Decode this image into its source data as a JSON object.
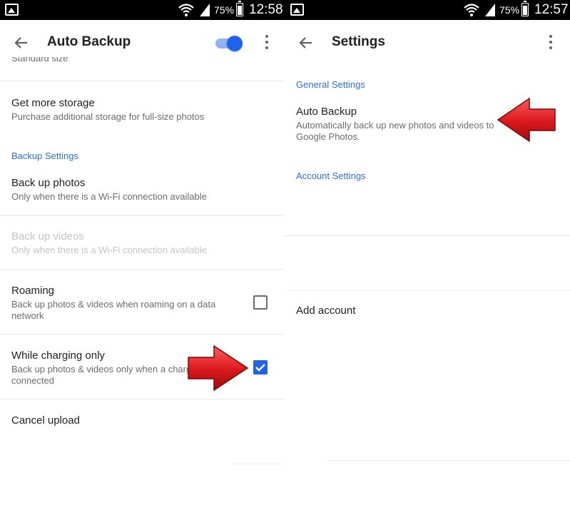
{
  "colors": {
    "accent": "#1e63e9",
    "section": "#2d6fd2",
    "arrow": "#d9181c"
  },
  "left_screen": {
    "status_bar": {
      "battery": "75%",
      "time": "12:58",
      "battery_level_fraction": 0.75
    },
    "app_bar": {
      "title": "Auto Backup",
      "auto_backup_enabled": true
    },
    "partial_text": "Standard size",
    "items": {
      "get_storage": {
        "title": "Get more storage",
        "subtitle": "Purchase additional storage for full-size photos"
      },
      "backup_settings_header": "Backup Settings",
      "backup_photos": {
        "title": "Back up photos",
        "subtitle": "Only when there is a Wi-Fi connection available"
      },
      "backup_videos": {
        "title": "Back up videos",
        "subtitle": "Only when there is a Wi-Fi connection available",
        "disabled": true
      },
      "roaming": {
        "title": "Roaming",
        "subtitle": "Back up photos & videos when roaming on a data network",
        "checked": false
      },
      "charging": {
        "title": "While charging only",
        "subtitle": "Back up photos & videos only when a charger is connected",
        "checked": true
      },
      "cancel_upload": {
        "title": "Cancel upload"
      }
    }
  },
  "right_screen": {
    "status_bar": {
      "battery": "75%",
      "time": "12:57",
      "battery_level_fraction": 0.75
    },
    "app_bar": {
      "title": "Settings"
    },
    "general_header": "General Settings",
    "auto_backup": {
      "title": "Auto Backup",
      "subtitle": "Automatically back up new photos and videos to Google Photos."
    },
    "account_header": "Account Settings",
    "add_account": {
      "title": "Add account"
    }
  },
  "icons": [
    "gallery-icon",
    "wifi-icon",
    "signal-icon",
    "battery-icon",
    "back-arrow-icon",
    "more-vert-icon",
    "check-icon",
    "red-arrow-icon"
  ]
}
